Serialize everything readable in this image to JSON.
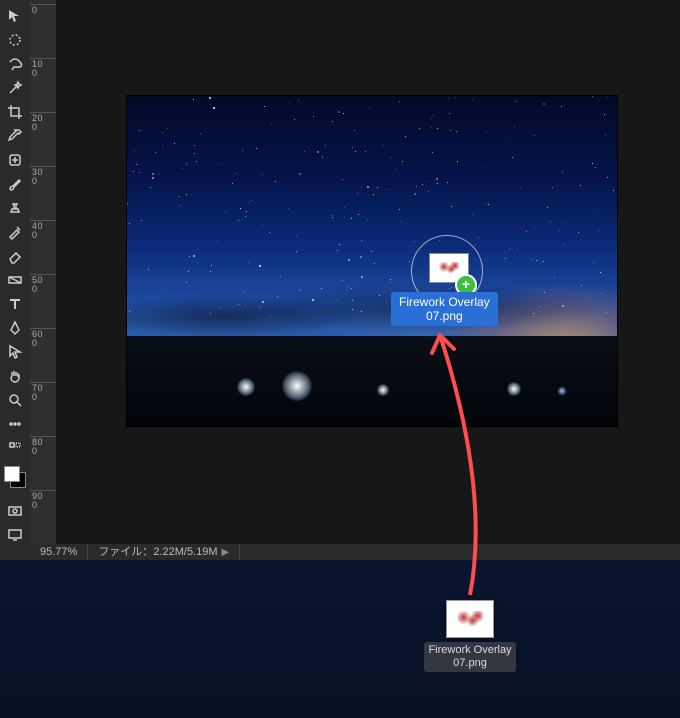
{
  "toolbar": {
    "tools": [
      {
        "name": "move-tool"
      },
      {
        "name": "marquee-tool"
      },
      {
        "name": "lasso-tool"
      },
      {
        "name": "magic-wand-tool"
      },
      {
        "name": "crop-tool"
      },
      {
        "name": "eyedropper-tool"
      },
      {
        "name": "healing-brush-tool"
      },
      {
        "name": "brush-tool"
      },
      {
        "name": "clone-stamp-tool"
      },
      {
        "name": "history-brush-tool"
      },
      {
        "name": "eraser-tool"
      },
      {
        "name": "gradient-tool"
      },
      {
        "name": "type-tool"
      },
      {
        "name": "pen-tool"
      },
      {
        "name": "path-selection-tool"
      },
      {
        "name": "hand-tool"
      },
      {
        "name": "zoom-tool"
      },
      {
        "name": "more-tools"
      },
      {
        "name": "edit-toolbar"
      }
    ],
    "swatches": {
      "fg": "#ffffff",
      "bg": "#000000"
    },
    "extra": [
      {
        "name": "quick-mask-toggle"
      },
      {
        "name": "screen-mode-toggle"
      }
    ]
  },
  "ruler": {
    "ticks": [
      0,
      100,
      200,
      300,
      400,
      500,
      600,
      700,
      800,
      900
    ],
    "labels": [
      "0",
      "1 0 0",
      "2 0 0",
      "3 0 0",
      "4 0 0",
      "5 0 0",
      "6 0 0",
      "7 0 0",
      "8 0 0",
      "9 0 0"
    ]
  },
  "status": {
    "zoom": "95.77%",
    "info_label": "ファイル：",
    "info_value": "2.22M/5.19M"
  },
  "drag": {
    "filename_line1": "Firework Overlay",
    "filename_line2": "07.png"
  },
  "desktop_file": {
    "name_line1": "Firework Overlay",
    "name_line2": "07.png"
  }
}
